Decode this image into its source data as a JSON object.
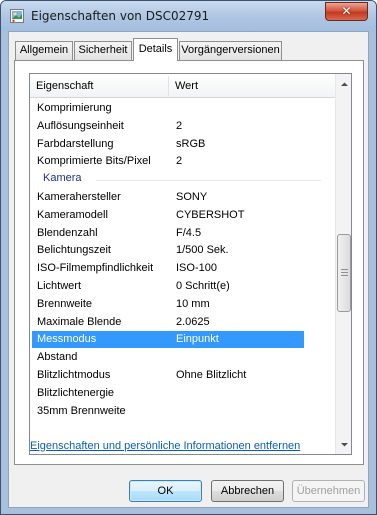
{
  "window": {
    "title": "Eigenschaften von DSC02791",
    "close_glyph": "✕",
    "icon": "image-file-icon"
  },
  "tabs": [
    {
      "label": "Allgemein",
      "active": false
    },
    {
      "label": "Sicherheit",
      "active": false
    },
    {
      "label": "Details",
      "active": true
    },
    {
      "label": "Vorgängerversionen",
      "active": false
    }
  ],
  "list": {
    "col_property": "Eigenschaft",
    "col_value": "Wert",
    "rows": [
      {
        "type": "row",
        "key": "Komprimierung",
        "value": ""
      },
      {
        "type": "row",
        "key": "Auflösungseinheit",
        "value": "2"
      },
      {
        "type": "row",
        "key": "Farbdarstellung",
        "value": "sRGB"
      },
      {
        "type": "row",
        "key": "Komprimierte Bits/Pixel",
        "value": "2"
      },
      {
        "type": "group",
        "label": "Kamera"
      },
      {
        "type": "row",
        "key": "Kamerahersteller",
        "value": "SONY"
      },
      {
        "type": "row",
        "key": "Kameramodell",
        "value": "CYBERSHOT"
      },
      {
        "type": "row",
        "key": "Blendenzahl",
        "value": "F/4.5"
      },
      {
        "type": "row",
        "key": "Belichtungszeit",
        "value": "1/500 Sek."
      },
      {
        "type": "row",
        "key": "ISO-Filmempfindlichkeit",
        "value": "ISO-100"
      },
      {
        "type": "row",
        "key": "Lichtwert",
        "value": "0 Schritt(e)"
      },
      {
        "type": "row",
        "key": "Brennweite",
        "value": "10 mm"
      },
      {
        "type": "row",
        "key": "Maximale Blende",
        "value": "2.0625"
      },
      {
        "type": "row",
        "key": "Messmodus",
        "value": "Einpunkt",
        "selected": true
      },
      {
        "type": "row",
        "key": "Abstand",
        "value": ""
      },
      {
        "type": "row",
        "key": "Blitzlichtmodus",
        "value": "Ohne Blitzlicht"
      },
      {
        "type": "row",
        "key": "Blitzlichtenergie",
        "value": ""
      },
      {
        "type": "row",
        "key": "35mm Brennweite",
        "value": ""
      }
    ]
  },
  "remove_link": "Eigenschaften und persönliche Informationen entfernen",
  "buttons": {
    "ok": "OK",
    "cancel": "Abbrechen",
    "apply": "Übernehmen"
  },
  "colors": {
    "selection": "#3399ff",
    "group_label": "#1e3287",
    "link": "#0a5eb6"
  }
}
